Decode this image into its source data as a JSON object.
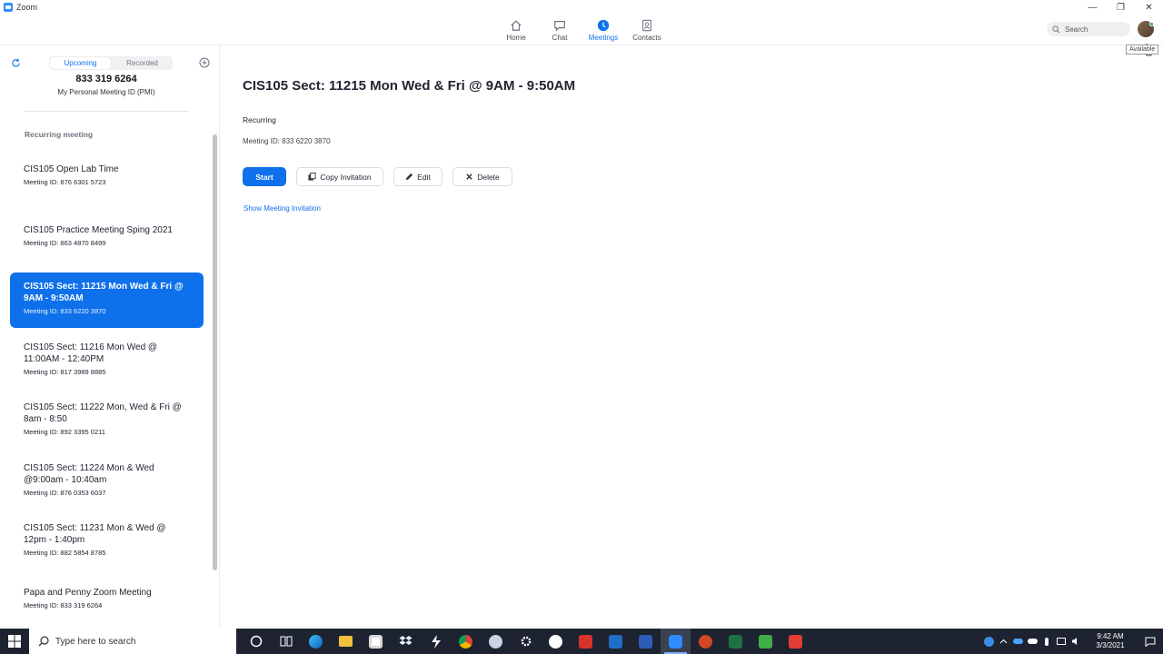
{
  "window": {
    "title": "Zoom",
    "minimize": "—",
    "restore": "❐",
    "close": "✕"
  },
  "nav": {
    "tabs": [
      {
        "label": "Home"
      },
      {
        "label": "Chat"
      },
      {
        "label": "Meetings"
      },
      {
        "label": "Contacts"
      }
    ],
    "active_tab": "Meetings",
    "search_placeholder": "Search",
    "tooltip": "Available",
    "accent_color": "#0E71EB"
  },
  "sidebar": {
    "tabs": [
      {
        "label": "Upcoming"
      },
      {
        "label": "Recorded"
      }
    ],
    "pmi_number": "833 319 6264",
    "pmi_label": "My Personal Meeting ID (PMI)",
    "section_title": "Recurring meeting",
    "meetings": [
      {
        "title": "CIS105 Open Lab Time",
        "id": "Meeting ID: 876 6301 5723"
      },
      {
        "title": "CIS105 Practice Meeting Sping 2021",
        "id": "Meeting ID: 863 4870 8499"
      },
      {
        "title": "CIS105 Sect: 11215 Mon Wed & Fri @ 9AM - 9:50AM",
        "id": "Meeting ID: 833 6220 3870"
      },
      {
        "title": "CIS105 Sect: 11216 Mon Wed  @ 11:00AM - 12:40PM",
        "id": "Meeting ID: 817 3989 8885"
      },
      {
        "title": "CIS105 Sect: 11222 Mon, Wed & Fri @ 8am - 8:50",
        "id": "Meeting ID: 892 3395 0211"
      },
      {
        "title": "CIS105 Sect: 11224 Mon & Wed @9:00am - 10:40am",
        "id": "Meeting ID: 876 0353 6037"
      },
      {
        "title": "CIS105 Sect: 11231 Mon & Wed @ 12pm - 1:40pm",
        "id": "Meeting ID: 882 5854 8785"
      },
      {
        "title": "Papa and Penny Zoom Meeting",
        "id": "Meeting ID: 833 319 6264"
      }
    ]
  },
  "detail": {
    "title": "CIS105 Sect: 11215 Mon Wed & Fri @ 9AM - 9:50AM",
    "recurring": "Recurring",
    "meeting_id": "Meeting ID: 833 6220 3870",
    "buttons": {
      "start": "Start",
      "copy": "Copy Invitation",
      "edit": "Edit",
      "delete": "Delete"
    },
    "show_invitation": "Show Meeting Invitation"
  },
  "taskbar": {
    "search_placeholder": "Type here to search",
    "time": "9:42 AM",
    "date": "3/3/2021"
  }
}
